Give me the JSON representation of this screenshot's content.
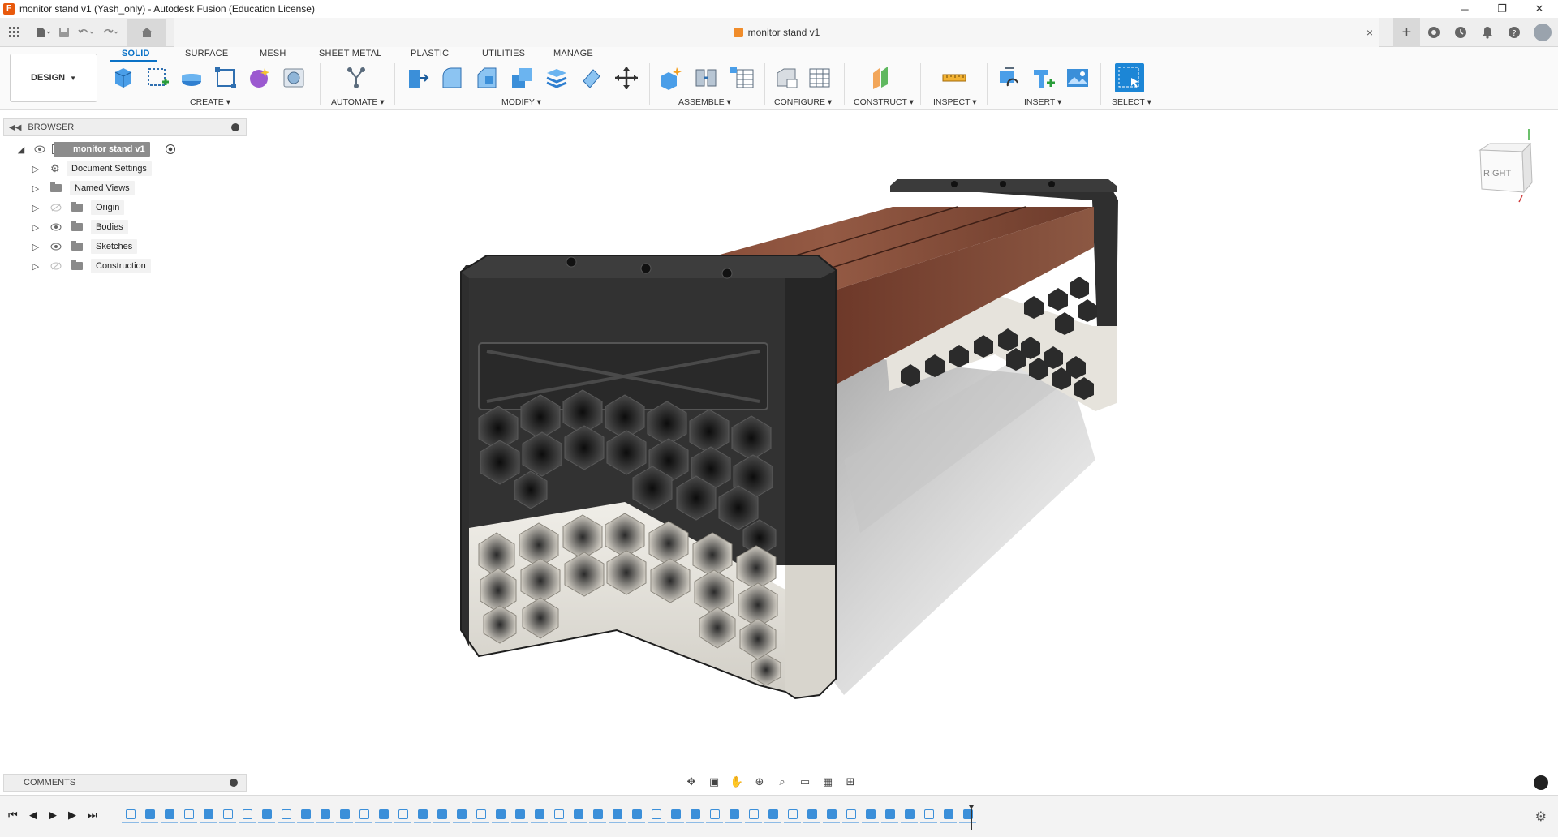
{
  "window": {
    "title": "monitor stand v1 (Yash_only) - Autodesk Fusion (Education License)",
    "controls": [
      "─",
      "❐",
      "✕"
    ]
  },
  "doc_tab": {
    "title": "monitor stand v1",
    "close": "×"
  },
  "ribbon": {
    "workspace": "DESIGN",
    "tabs": [
      "SOLID",
      "SURFACE",
      "MESH",
      "SHEET METAL",
      "PLASTIC",
      "UTILITIES",
      "MANAGE"
    ],
    "active_tab": "SOLID",
    "groups": [
      "CREATE",
      "AUTOMATE",
      "MODIFY",
      "ASSEMBLE",
      "CONFIGURE",
      "CONSTRUCT",
      "INSPECT",
      "INSERT",
      "SELECT"
    ],
    "accent": "#0a72c7"
  },
  "browser": {
    "title": "BROWSER",
    "root": "monitor stand v1",
    "items": [
      {
        "label": "Document Settings",
        "icon": "gear-icon"
      },
      {
        "label": "Named Views",
        "icon": "folder-icon"
      },
      {
        "label": "Origin",
        "icon": "folder-icon"
      },
      {
        "label": "Bodies",
        "icon": "folder-icon"
      },
      {
        "label": "Sketches",
        "icon": "folder-icon"
      },
      {
        "label": "Construction",
        "icon": "folder-icon"
      }
    ]
  },
  "viewcube": {
    "face": "RIGHT"
  },
  "comments": {
    "title": "COMMENTS"
  },
  "model": {
    "wood_color": "#8a4e3a",
    "dark_leg_color": "#2f2f2f",
    "light_leg_color": "#e4e1da"
  }
}
